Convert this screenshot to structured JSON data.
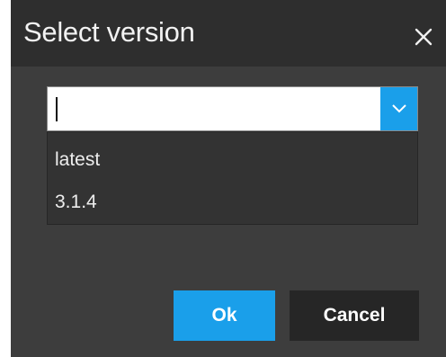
{
  "dialog": {
    "title": "Select version",
    "close_icon": "close-icon"
  },
  "combobox": {
    "value": "",
    "dropdown_icon": "chevron-down-icon",
    "options": [
      "latest",
      "3.1.4"
    ]
  },
  "buttons": {
    "ok_label": "Ok",
    "cancel_label": "Cancel"
  },
  "colors": {
    "accent": "#1a9fea",
    "dialog_bg": "#3d3d3d",
    "titlebar_bg": "#2e2e2e",
    "cancel_bg": "#262626"
  }
}
